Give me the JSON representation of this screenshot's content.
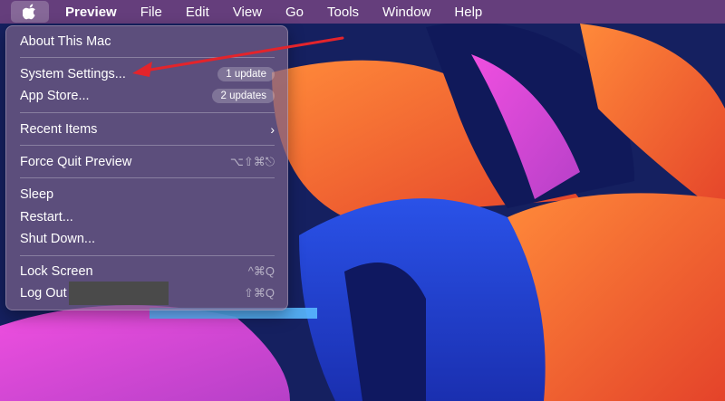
{
  "menubar": {
    "apple_icon": "apple-logo-icon",
    "app_name": "Preview",
    "items": [
      "File",
      "Edit",
      "View",
      "Go",
      "Tools",
      "Window",
      "Help"
    ]
  },
  "apple_menu": {
    "about": "About This Mac",
    "system_settings": {
      "label": "System Settings...",
      "badge": "1 update"
    },
    "app_store": {
      "label": "App Store...",
      "badge": "2 updates"
    },
    "recent_items": {
      "label": "Recent Items",
      "chevron": "›"
    },
    "force_quit": {
      "label": "Force Quit Preview",
      "shortcut": "⌥⇧⌘⎋"
    },
    "sleep": "Sleep",
    "restart": "Restart...",
    "shut_down": "Shut Down...",
    "lock_screen": {
      "label": "Lock Screen",
      "shortcut": "^⌘Q"
    },
    "log_out": {
      "label": "Log Out",
      "shortcut": "⇧⌘Q"
    }
  },
  "annotation": {
    "arrow_color": "#e3242b"
  },
  "colors": {
    "menu_accent": "#ffffff",
    "wallpaper_orange": "#f26a2e",
    "wallpaper_blue": "#1f3fd0",
    "wallpaper_magenta": "#d94fd6"
  }
}
